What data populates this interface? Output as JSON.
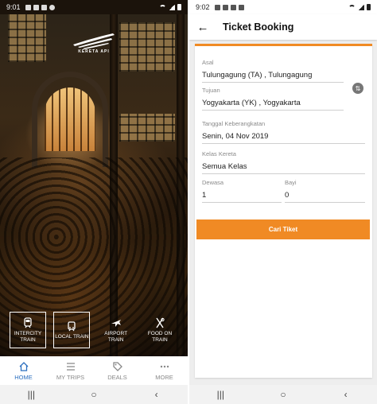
{
  "left_screen": {
    "status": {
      "time": "9:01"
    },
    "logo": {
      "text": "KERETA API"
    },
    "shortcuts": [
      {
        "label": "INTERCITY TRAIN",
        "icon": "train-icon"
      },
      {
        "label": "LOCAL TRAIN",
        "icon": "tram-icon"
      },
      {
        "label": "AIRPORT TRAIN",
        "icon": "airplane-icon"
      },
      {
        "label": "FOOD ON TRAIN",
        "icon": "cutlery-icon"
      }
    ],
    "bottom_nav": [
      {
        "label": "HOME",
        "icon": "home-icon",
        "active": true
      },
      {
        "label": "MY TRIPS",
        "icon": "list-icon",
        "active": false
      },
      {
        "label": "DEALS",
        "icon": "tag-icon",
        "active": false
      },
      {
        "label": "MORE",
        "icon": "more-dots-icon",
        "active": false
      }
    ]
  },
  "right_screen": {
    "status": {
      "time": "9:02"
    },
    "app_bar": {
      "title": "Ticket Booking"
    },
    "form": {
      "origin": {
        "label": "Asal",
        "value": "Tulungagung (TA) , Tulungagung"
      },
      "destination": {
        "label": "Tujuan",
        "value": "Yogyakarta (YK) , Yogyakarta"
      },
      "departure_date": {
        "label": "Tanggal Keberangkatan",
        "value": "Senin, 04 Nov 2019"
      },
      "train_class": {
        "label": "Kelas Kereta",
        "value": "Semua Kelas"
      },
      "adults": {
        "label": "Dewasa",
        "value": "1"
      },
      "infants": {
        "label": "Bayi",
        "value": "0"
      },
      "search_button": "Cari Tiket"
    }
  },
  "system_nav": {
    "recents": "|||",
    "home": "○",
    "back": "‹"
  },
  "colors": {
    "accent": "#f08a24",
    "nav_active": "#2b6fbf"
  }
}
